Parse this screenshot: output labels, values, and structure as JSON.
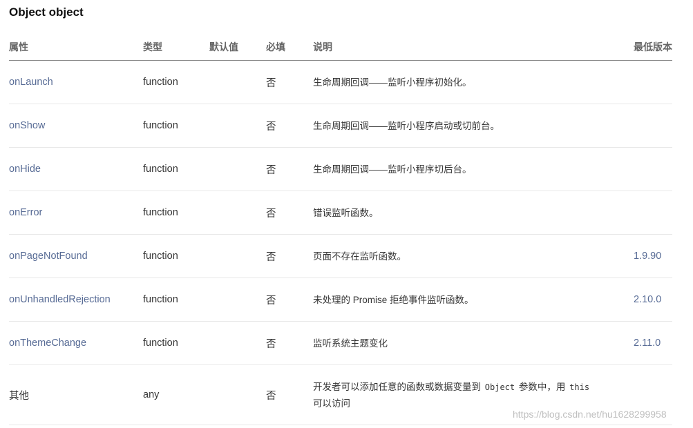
{
  "title": "Object object",
  "headers": [
    "属性",
    "类型",
    "默认值",
    "必填",
    "说明",
    "最低版本"
  ],
  "rows": [
    {
      "name": "onLaunch",
      "type": "function",
      "default": "",
      "required": "否",
      "desc": "生命周期回调——监听小程序初始化。",
      "version": ""
    },
    {
      "name": "onShow",
      "type": "function",
      "default": "",
      "required": "否",
      "desc": "生命周期回调——监听小程序启动或切前台。",
      "version": ""
    },
    {
      "name": "onHide",
      "type": "function",
      "default": "",
      "required": "否",
      "desc": "生命周期回调——监听小程序切后台。",
      "version": ""
    },
    {
      "name": "onError",
      "type": "function",
      "default": "",
      "required": "否",
      "desc": "错误监听函数。",
      "version": ""
    },
    {
      "name": "onPageNotFound",
      "type": "function",
      "default": "",
      "required": "否",
      "desc": "页面不存在监听函数。",
      "version": "1.9.90"
    },
    {
      "name": "onUnhandledRejection",
      "type": "function",
      "default": "",
      "required": "否",
      "desc": "未处理的 Promise 拒绝事件监听函数。",
      "version": "2.10.0"
    },
    {
      "name": "onThemeChange",
      "type": "function",
      "default": "",
      "required": "否",
      "desc": "监听系统主题变化",
      "version": "2.11.0"
    }
  ],
  "last_row": {
    "name": "其他",
    "type": "any",
    "default": "",
    "required": "否",
    "desc_part1": "开发者可以添加任意的函数或数据变量到",
    "desc_code1": "Object",
    "desc_part2": "参数中，用",
    "desc_code2": "this",
    "desc_part3": "可以访问",
    "version": ""
  },
  "watermark": "https://blog.csdn.net/hu1628299958"
}
